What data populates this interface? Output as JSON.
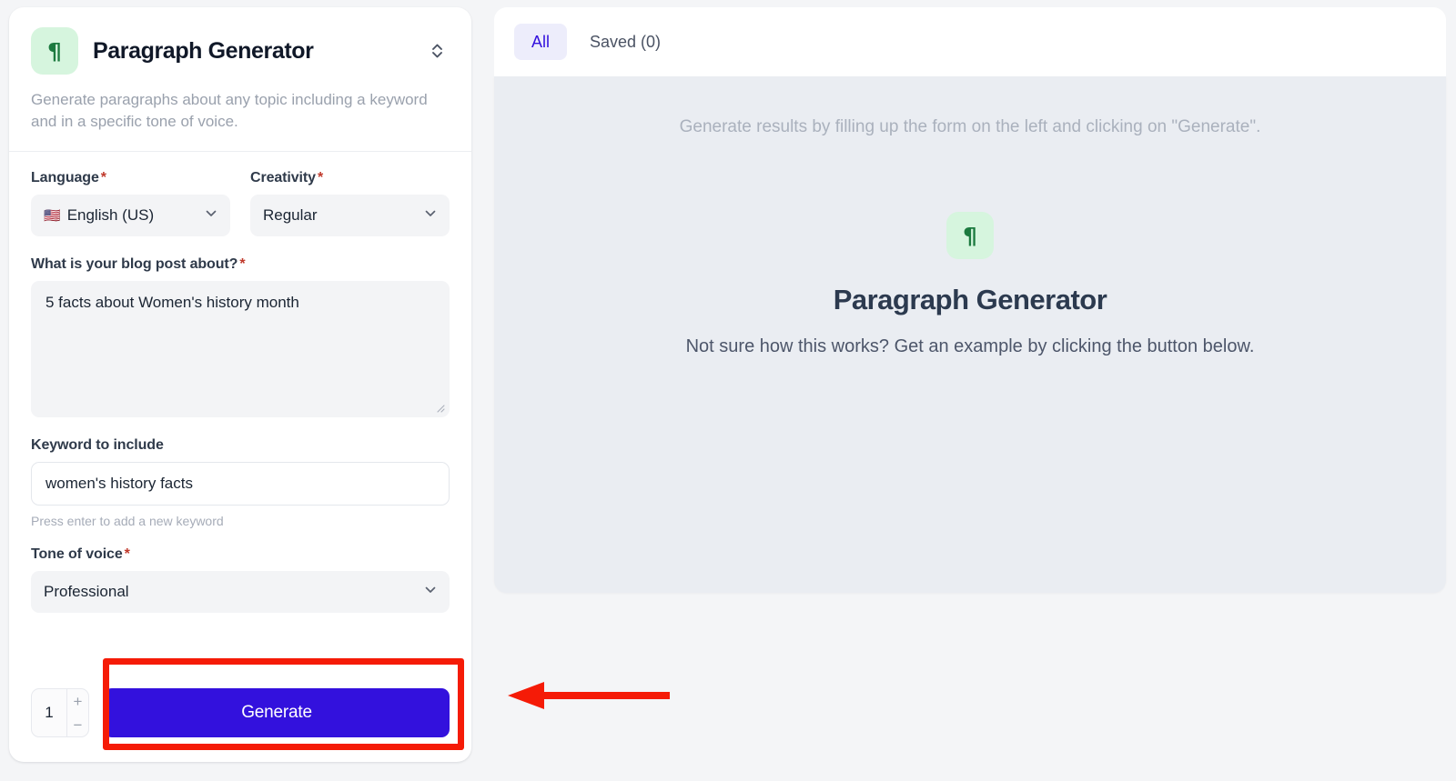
{
  "tool": {
    "icon": "¶",
    "icon_name": "paragraph-pilcrow-icon",
    "title": "Paragraph Generator",
    "description": "Generate paragraphs about any topic including a keyword and in a specific tone of voice.",
    "icon_bg": "#d6f5de",
    "icon_color": "#1c7a3f"
  },
  "form": {
    "language": {
      "label": "Language",
      "required": "*",
      "flag": "🇺🇸",
      "value": "English (US)"
    },
    "creativity": {
      "label": "Creativity",
      "required": "*",
      "value": "Regular"
    },
    "topic": {
      "label": "What is your blog post about?",
      "required": "*",
      "value": "5 facts about Women's history month",
      "placeholder": ""
    },
    "keyword": {
      "label": "Keyword to include",
      "value": "women's history facts",
      "placeholder": "",
      "hint": "Press enter to add a new keyword"
    },
    "tone": {
      "label": "Tone of voice",
      "required": "*",
      "value": "Professional"
    }
  },
  "footer": {
    "quantity": "1",
    "increment_label": "+",
    "decrement_label": "−",
    "generate_label": "Generate",
    "generate_color": "#3311dd"
  },
  "results": {
    "tabs": [
      {
        "label": "All",
        "active": true
      },
      {
        "label": "Saved (0)",
        "active": false
      }
    ],
    "hint": "Generate results by filling up the form on the left and clicking on \"Generate\".",
    "empty_state": {
      "icon": "¶",
      "title": "Paragraph Generator",
      "subtitle": "Not sure how this works? Get an example by clicking the button below."
    }
  },
  "annotation": {
    "highlight_color": "#f51b07",
    "arrow_color": "#f51b07",
    "arrow_direction": "left"
  }
}
